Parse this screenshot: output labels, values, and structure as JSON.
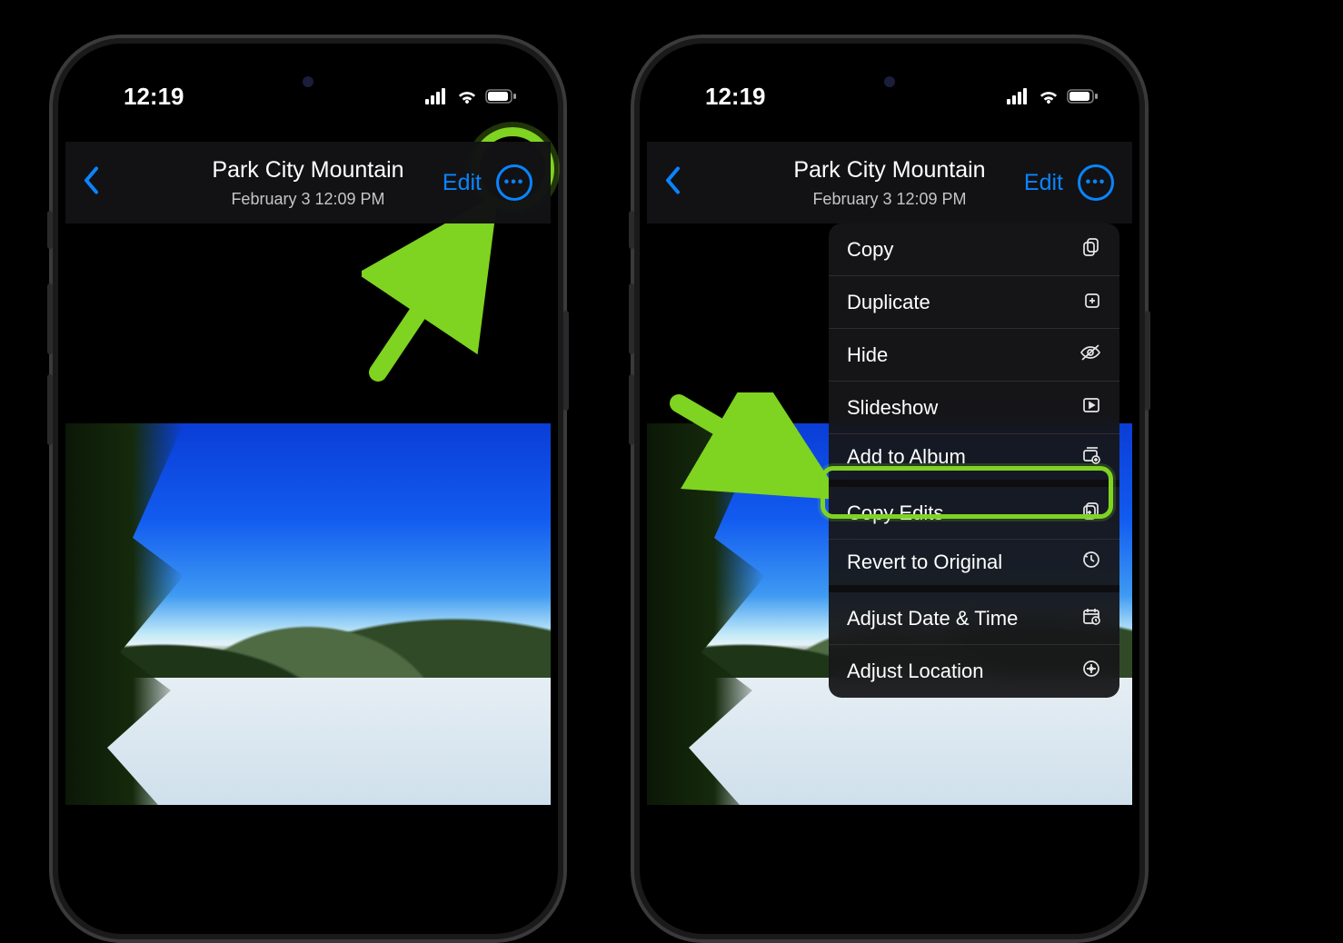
{
  "status": {
    "time": "12:19"
  },
  "nav": {
    "title": "Park City Mountain",
    "subtitle": "February 3  12:09 PM",
    "edit": "Edit"
  },
  "menu": {
    "items": [
      {
        "label": "Copy"
      },
      {
        "label": "Duplicate"
      },
      {
        "label": "Hide"
      },
      {
        "label": "Slideshow"
      },
      {
        "label": "Add to Album"
      },
      {
        "label": "Copy Edits"
      },
      {
        "label": "Revert to Original"
      },
      {
        "label": "Adjust Date & Time"
      },
      {
        "label": "Adjust Location"
      }
    ]
  }
}
